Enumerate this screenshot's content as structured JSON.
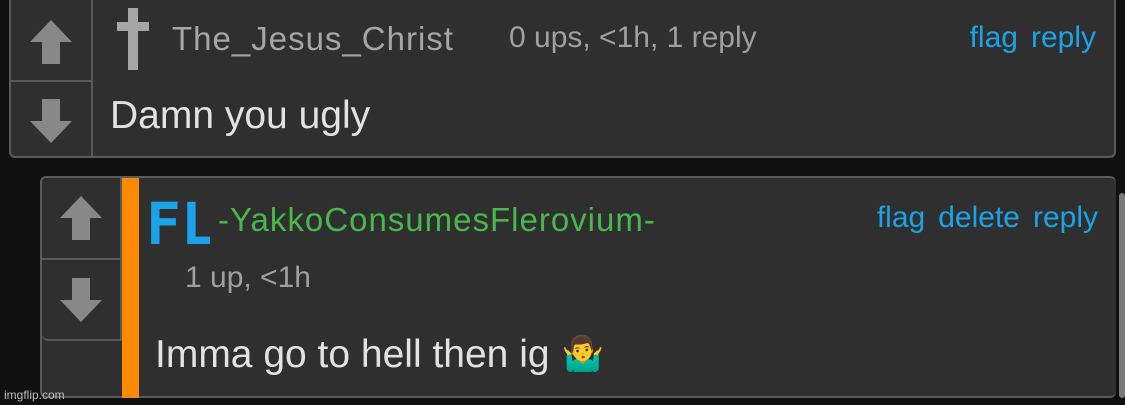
{
  "comments": [
    {
      "username": "The_Jesus_Christ",
      "meta": "0 ups, <1h, 1 reply",
      "actions": [
        "flag",
        "reply"
      ],
      "body": "Damn you ugly",
      "avatar_icon": "cross-icon"
    },
    {
      "username": "-YakkoConsumesFlerovium-",
      "meta": "1 up, <1h",
      "actions": [
        "flag",
        "delete",
        "reply"
      ],
      "body": "Imma go to hell then ig",
      "emoji": "🤷‍♂️",
      "avatar_icon": "fl-element-icon",
      "avatar_text": "FL"
    }
  ],
  "vote_icons": [
    "upvote-arrow-icon",
    "downvote-arrow-icon"
  ],
  "watermark": "imgflip.com",
  "colors": {
    "link": "#1aa3e8",
    "username_green": "#47b94c",
    "highlight_bar": "#ff8a00",
    "panel": "#2f2f2f",
    "background": "#101010"
  }
}
